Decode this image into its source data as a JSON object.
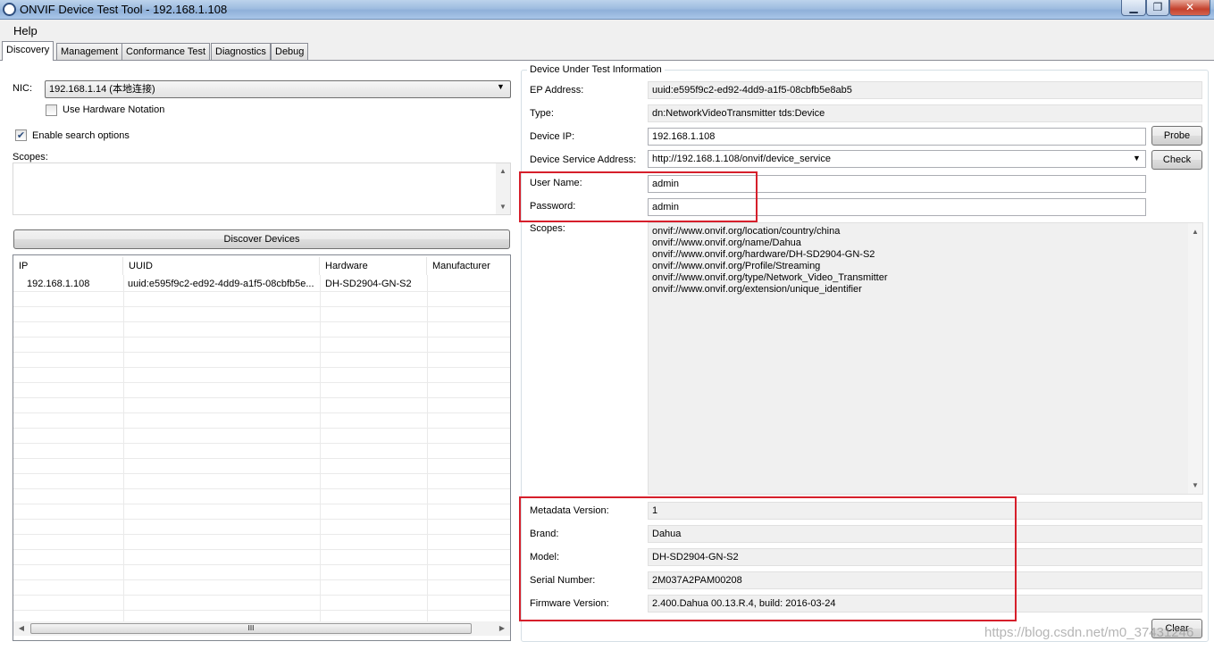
{
  "window": {
    "title": "ONVIF Device Test Tool - 192.168.1.108",
    "min_icon": "minimize-icon",
    "max_icon": "maximize-icon",
    "close_icon": "close-icon"
  },
  "menu": {
    "help": "Help"
  },
  "tabs": [
    {
      "label": "Discovery",
      "active": true
    },
    {
      "label": "Management"
    },
    {
      "label": "Conformance Test"
    },
    {
      "label": "Diagnostics"
    },
    {
      "label": "Debug"
    }
  ],
  "discovery": {
    "nic_label": "NIC:",
    "nic_value": "192.168.1.14 (本地连接)",
    "use_hw_notation": "Use Hardware Notation",
    "use_hw_checked": false,
    "enable_search": "Enable search options",
    "enable_search_checked": true,
    "scopes_label": "Scopes:",
    "discover_button": "Discover Devices",
    "columns": [
      "IP",
      "UUID",
      "Hardware",
      "Manufacturer"
    ],
    "rows": [
      [
        "192.168.1.108",
        "uuid:e595f9c2-ed92-4dd9-a1f5-08cbfb5e...",
        "DH-SD2904-GN-S2",
        ""
      ]
    ],
    "hscroll_thumb": "III"
  },
  "dut": {
    "group_title": "Device Under Test Information",
    "ep_label": "EP Address:",
    "ep_value": "uuid:e595f9c2-ed92-4dd9-a1f5-08cbfb5e8ab5",
    "type_label": "Type:",
    "type_value": "dn:NetworkVideoTransmitter tds:Device",
    "ip_label": "Device IP:",
    "ip_value": "192.168.1.108",
    "probe_button": "Probe",
    "service_label": "Device Service Address:",
    "service_value": "http://192.168.1.108/onvif/device_service",
    "check_button": "Check",
    "user_label": "User Name:",
    "user_value": "admin",
    "password_label": "Password:",
    "password_value": "admin",
    "scopes_label": "Scopes:",
    "scopes": [
      "onvif://www.onvif.org/location/country/china",
      "onvif://www.onvif.org/name/Dahua",
      "onvif://www.onvif.org/hardware/DH-SD2904-GN-S2",
      "onvif://www.onvif.org/Profile/Streaming",
      "onvif://www.onvif.org/type/Network_Video_Transmitter",
      "onvif://www.onvif.org/extension/unique_identifier"
    ],
    "metadata_label": "Metadata Version:",
    "metadata_value": "1",
    "brand_label": "Brand:",
    "brand_value": "Dahua",
    "model_label": "Model:",
    "model_value": "DH-SD2904-GN-S2",
    "serial_label": "Serial Number:",
    "serial_value": "2M037A2PAM00208",
    "firmware_label": "Firmware Version:",
    "firmware_value": "2.400.Dahua 00.13.R.4, build: 2016-03-24",
    "clear_button": "Clear"
  },
  "watermark": "https://blog.csdn.net/m0_37431246",
  "colors": {
    "highlight_box": "#d61f2b",
    "title_bar": "#9fbde0"
  }
}
